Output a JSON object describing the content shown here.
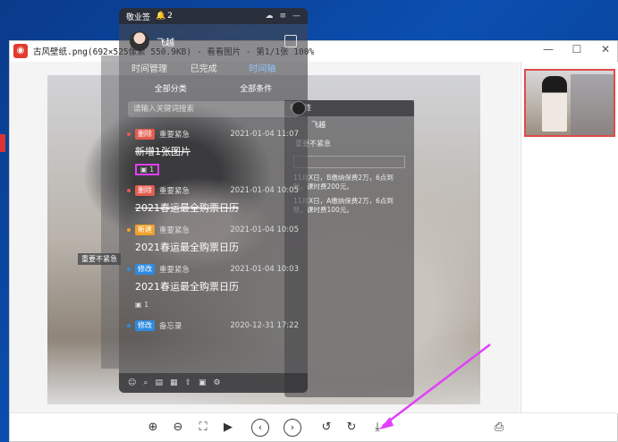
{
  "viewer": {
    "title": "古风壁纸.png(692×525像素 550.9KB) - 看看图片 - 第1/1张 100%",
    "controls": {
      "minimize": "—",
      "maximize": "☐",
      "close": "✕"
    },
    "toolbar": [
      "zoom-in-icon",
      "zoom-out-icon",
      "fit-icon",
      "play-icon",
      "prev-icon",
      "next-icon",
      "rotate-left-icon",
      "rotate-right-icon",
      "save-icon",
      "print-icon"
    ]
  },
  "notes_app": {
    "app_name": "敬业签",
    "notification_count": "2",
    "username": "飞越",
    "tabs": [
      {
        "label": "时间管理",
        "active": false
      },
      {
        "label": "已完成",
        "active": false
      },
      {
        "label": "时间轴",
        "active": true
      }
    ],
    "filters": {
      "category": "全部分类",
      "condition": "全部条件"
    },
    "search_placeholder": "请输入关键词搜索",
    "items": [
      {
        "tag": "删除",
        "tag_type": "del",
        "priority": "重要紧急",
        "time": "2021-01-04 11:07",
        "title": "新增1张图片",
        "strike": true,
        "sub": "1",
        "highlight": true
      },
      {
        "tag": "删除",
        "tag_type": "del",
        "priority": "重要紧急",
        "time": "2021-01-04 10:05",
        "title": "2021春运最全购票日历",
        "strike": true,
        "sub": "",
        "highlight": false
      },
      {
        "tag": "新建",
        "tag_type": "new",
        "priority": "重要紧急",
        "time": "2021-01-04 10:05",
        "title": "2021春运最全购票日历",
        "strike": false,
        "sub": "",
        "highlight": false
      },
      {
        "tag": "修改",
        "tag_type": "mod",
        "priority": "重要紧急",
        "time": "2021-01-04 10:03",
        "title": "2021春运最全购票日历",
        "strike": false,
        "sub": "1",
        "highlight": false
      },
      {
        "tag": "修改",
        "tag_type": "mod",
        "priority": "备忘录",
        "time": "2020-12-31 17:22",
        "title": "",
        "strike": false,
        "sub": "",
        "highlight": false
      }
    ]
  },
  "panel2": {
    "header": "敬业签",
    "user": "飞越",
    "tag": "重要不紧急",
    "lines": [
      "11月X日，B缴纳保费2万，6点到账，课时费200元。",
      "11月X日，A缴纳保费2万，6点到账，课时费100元。"
    ]
  },
  "strip": {
    "label": "重要不紧急"
  },
  "colors": {
    "accent_red": "#e24a4a",
    "arrow": "#e040fb",
    "tab_active": "#8fc3ff"
  }
}
